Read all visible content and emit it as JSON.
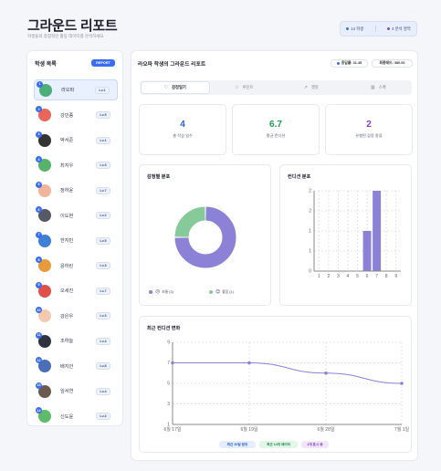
{
  "header": {
    "title": "그라운드 리포트",
    "subtitle": "학생들의 종합적인 활동 데이터를 분석하세요",
    "stats": [
      {
        "label": "14 학생",
        "color": "#3b6df0"
      },
      {
        "label": "4 분석 영역",
        "color": "#7a4fe0"
      }
    ]
  },
  "sidebar": {
    "title": "학생 목록",
    "report_button": "REPORT",
    "students": [
      {
        "num": "1",
        "name": "라오파",
        "level": "Lv.1",
        "avatar_color": "#4caf78"
      },
      {
        "num": "2",
        "name": "강민종",
        "level": "Lv.5",
        "avatar_color": "#e8665a"
      },
      {
        "num": "3",
        "name": "박서준",
        "level": "Lv.1",
        "avatar_color": "#333333"
      },
      {
        "num": "4",
        "name": "최지우",
        "level": "Lv.3",
        "avatar_color": "#58b36a"
      },
      {
        "num": "5",
        "name": "정하윤",
        "level": "Lv.7",
        "avatar_color": "#f2b59b"
      },
      {
        "num": "6",
        "name": "이도현",
        "level": "Lv.2",
        "avatar_color": "#555a66"
      },
      {
        "num": "7",
        "name": "한지민",
        "level": "Lv.5",
        "avatar_color": "#3f7fd8"
      },
      {
        "num": "8",
        "name": "윤하린",
        "level": "Lv.3",
        "avatar_color": "#e89a3c"
      },
      {
        "num": "9",
        "name": "오세진",
        "level": "Lv.7",
        "avatar_color": "#e0504a"
      },
      {
        "num": "10",
        "name": "강은우",
        "level": "Lv.3",
        "avatar_color": "#f4c9b0"
      },
      {
        "num": "11",
        "name": "조하늘",
        "level": "Lv.4",
        "avatar_color": "#2f3340"
      },
      {
        "num": "12",
        "name": "배지안",
        "level": "Lv.8",
        "avatar_color": "#4a6fb8"
      },
      {
        "num": "13",
        "name": "임서연",
        "level": "Lv.4",
        "avatar_color": "#6c5a4e"
      },
      {
        "num": "14",
        "name": "신도윤",
        "level": "Lv.3",
        "avatar_color": "#5dbb6a"
      }
    ]
  },
  "main": {
    "title": "라오파 학생의 그라운드 리포트",
    "pill_left": "응답률: 31.45",
    "pill_right": "최종레드: 380.00",
    "tabs": [
      {
        "label": "감정일기",
        "icon": "♡"
      },
      {
        "label": "루틴트",
        "icon": "☆"
      },
      {
        "label": "챗봇",
        "icon": "↗"
      },
      {
        "label": "스펙",
        "icon": "▥"
      }
    ],
    "metrics": [
      {
        "value": "4",
        "label": "총 작성 일수",
        "color": "#2f5fd8"
      },
      {
        "value": "6.7",
        "label": "평균 컨디션",
        "color": "#1f9a58"
      },
      {
        "value": "2",
        "label": "유형된 감정 종류",
        "color": "#8a3fcf"
      }
    ],
    "emotion_chart_title": "감정별 분포",
    "condition_chart_title": "컨디션 분포",
    "trend_chart_title": "최근 컨디션 변화",
    "badges": [
      {
        "label": "최근 30일 범위",
        "bg": "#e5edff",
        "fg": "#2f5fd8"
      },
      {
        "label": "최근 14개 데이터",
        "bg": "#e4f6ea",
        "fg": "#1f8a4c"
      },
      {
        "label": "4개 표시 중",
        "bg": "#f1e6fb",
        "fg": "#8a3fcf"
      }
    ]
  },
  "chart_data": [
    {
      "type": "pie",
      "title": "감정별 분포",
      "categories": [
        "보통",
        "좋음"
      ],
      "values": [
        3,
        1
      ],
      "colors": [
        "#8b82d8",
        "#86ca9a"
      ],
      "legend": [
        "보통 (3)",
        "좋음 (1)"
      ],
      "legend_placement": "bottom"
    },
    {
      "type": "bar",
      "title": "컨디션 분포",
      "categories": [
        "1",
        "2",
        "3",
        "4",
        "5",
        "6",
        "7",
        "8",
        "9"
      ],
      "values": [
        0,
        0,
        0,
        0,
        0,
        1,
        2,
        0,
        0
      ],
      "ylim": [
        0,
        2
      ],
      "yticks": [
        "0",
        "1",
        "1",
        "2",
        "2"
      ],
      "color": "#8b82d8",
      "grid": true
    },
    {
      "type": "line",
      "title": "최근 컨디션 변화",
      "x": [
        "6월 17일",
        "6월 19일",
        "6월 28일",
        "7월 1일"
      ],
      "values": [
        7,
        7,
        6,
        5
      ],
      "ylim": [
        1,
        9
      ],
      "yticks": [
        "1",
        "3",
        "5",
        "7",
        "9"
      ],
      "color": "#8b82d8",
      "grid": true
    }
  ]
}
